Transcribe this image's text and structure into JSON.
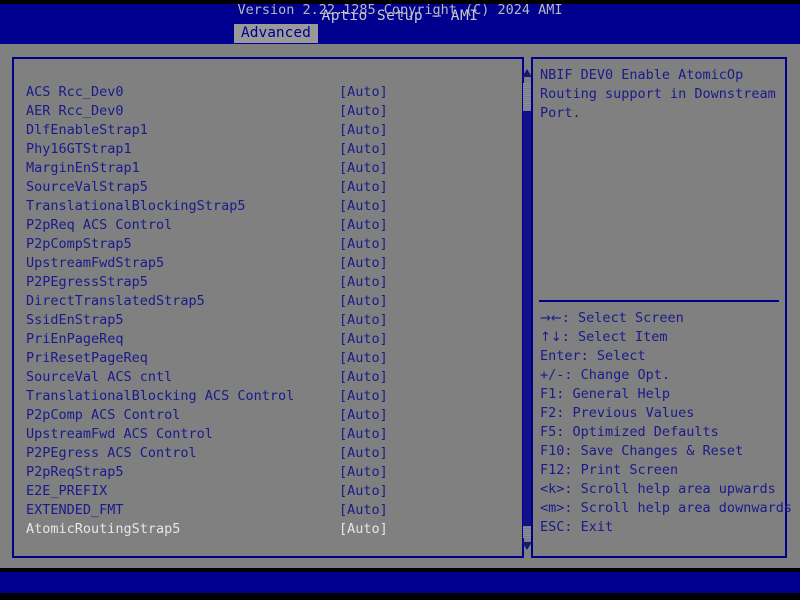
{
  "header": {
    "title": "Aptio Setup – AMI",
    "tabs": [
      {
        "label": "Advanced",
        "active": true
      }
    ]
  },
  "options": {
    "value_column_header": "",
    "rows": [
      {
        "label": "ACS Rcc_Dev0",
        "value": "[Auto]",
        "selected": false
      },
      {
        "label": "AER Rcc_Dev0",
        "value": "[Auto]",
        "selected": false
      },
      {
        "label": "DlfEnableStrap1",
        "value": "[Auto]",
        "selected": false
      },
      {
        "label": "Phy16GTStrap1",
        "value": "[Auto]",
        "selected": false
      },
      {
        "label": "MarginEnStrap1",
        "value": "[Auto]",
        "selected": false
      },
      {
        "label": "SourceValStrap5",
        "value": "[Auto]",
        "selected": false
      },
      {
        "label": "TranslationalBlockingStrap5",
        "value": "[Auto]",
        "selected": false
      },
      {
        "label": "P2pReq ACS Control",
        "value": "[Auto]",
        "selected": false
      },
      {
        "label": "P2pCompStrap5",
        "value": "[Auto]",
        "selected": false
      },
      {
        "label": "UpstreamFwdStrap5",
        "value": "[Auto]",
        "selected": false
      },
      {
        "label": "P2PEgressStrap5",
        "value": "[Auto]",
        "selected": false
      },
      {
        "label": "DirectTranslatedStrap5",
        "value": "[Auto]",
        "selected": false
      },
      {
        "label": "SsidEnStrap5",
        "value": "[Auto]",
        "selected": false
      },
      {
        "label": "PriEnPageReq",
        "value": "[Auto]",
        "selected": false
      },
      {
        "label": "PriResetPageReq",
        "value": "[Auto]",
        "selected": false
      },
      {
        "label": "SourceVal ACS cntl",
        "value": "[Auto]",
        "selected": false
      },
      {
        "label": "TranslationalBlocking ACS Control",
        "value": "[Auto]",
        "selected": false
      },
      {
        "label": "P2pComp ACS Control",
        "value": "[Auto]",
        "selected": false
      },
      {
        "label": "UpstreamFwd ACS Control",
        "value": "[Auto]",
        "selected": false
      },
      {
        "label": "P2PEgress ACS Control",
        "value": "[Auto]",
        "selected": false
      },
      {
        "label": "P2pReqStrap5",
        "value": "[Auto]",
        "selected": false
      },
      {
        "label": "E2E_PREFIX",
        "value": "[Auto]",
        "selected": false
      },
      {
        "label": "EXTENDED_FMT",
        "value": "[Auto]",
        "selected": false
      },
      {
        "label": "AtomicRoutingStrap5",
        "value": "[Auto]",
        "selected": true
      }
    ]
  },
  "scrollbar": {
    "up_arrow": "scroll-up-arrow",
    "down_arrow": "scroll-down-arrow"
  },
  "help": {
    "description": "NBIF DEV0 Enable AtomicOp Routing support in Downstream Port.",
    "keys": [
      {
        "glyph": "→←",
        "text": ": Select Screen"
      },
      {
        "glyph": "↑↓",
        "text": ": Select Item"
      },
      {
        "glyph": "",
        "text": "Enter: Select"
      },
      {
        "glyph": "",
        "text": "+/-: Change Opt."
      },
      {
        "glyph": "",
        "text": "F1: General Help"
      },
      {
        "glyph": "",
        "text": "F2: Previous Values"
      },
      {
        "glyph": "",
        "text": "F5: Optimized Defaults"
      },
      {
        "glyph": "",
        "text": "F10: Save Changes & Reset"
      },
      {
        "glyph": "",
        "text": "F12: Print Screen"
      },
      {
        "glyph": "",
        "text": "<k>: Scroll help area upwards"
      },
      {
        "glyph": "",
        "text": "<m>: Scroll help area downwards"
      },
      {
        "glyph": "",
        "text": "ESC: Exit"
      }
    ]
  },
  "footer": {
    "version_text": "Version 2.22.1285 Copyright (C) 2024 AMI"
  },
  "colors": {
    "header_blue": "#00008f",
    "body_gray": "#808080",
    "text_blue": "#1a1a8c",
    "selected_text": "#e6e6e6",
    "footer_text": "#b9b9b9",
    "tab_active_bg": "#9a9a9a"
  }
}
